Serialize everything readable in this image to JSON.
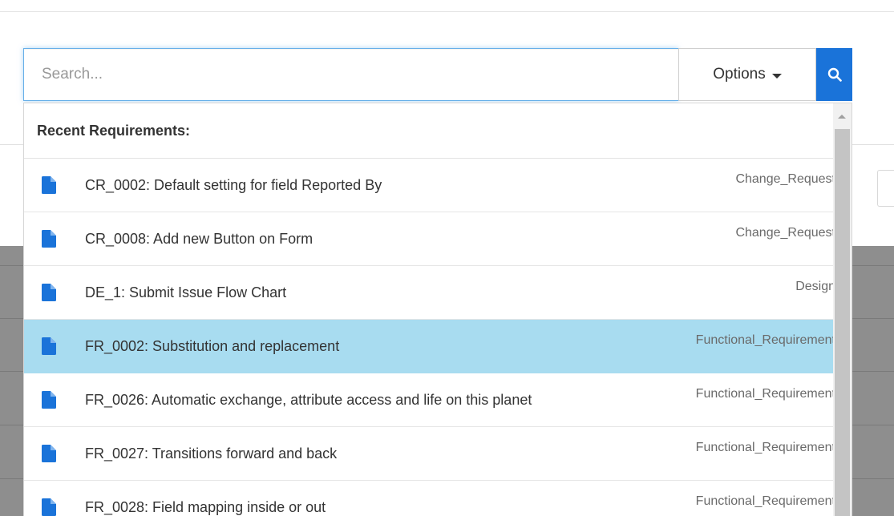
{
  "search": {
    "placeholder": "Search...",
    "value": "",
    "options_label": "Options",
    "button_icon": "search-icon"
  },
  "dropdown": {
    "header": "Recent Requirements:",
    "items": [
      {
        "title": "CR_0002: Default setting for field Reported By",
        "type": "Change_Request",
        "icon": "document-icon",
        "selected": false
      },
      {
        "title": "CR_0008: Add new Button on Form",
        "type": "Change_Request",
        "icon": "document-icon",
        "selected": false
      },
      {
        "title": "DE_1: Submit Issue Flow Chart",
        "type": "Design",
        "icon": "document-icon",
        "selected": false
      },
      {
        "title": "FR_0002: Substitution and replacement",
        "type": "Functional_Requirement",
        "icon": "document-icon",
        "selected": true
      },
      {
        "title": "FR_0026: Automatic exchange, attribute access and life on this planet",
        "type": "Functional_Requirement",
        "icon": "document-icon",
        "selected": false
      },
      {
        "title": "FR_0027: Transitions forward and back",
        "type": "Functional_Requirement",
        "icon": "document-icon",
        "selected": false
      },
      {
        "title": "FR_0028: Field mapping inside or out",
        "type": "Functional_Requirement",
        "icon": "document-icon",
        "selected": false
      }
    ]
  },
  "colors": {
    "accent": "#1a73d9",
    "selected_row": "#a8dcf0",
    "icon": "#1a73d9"
  }
}
